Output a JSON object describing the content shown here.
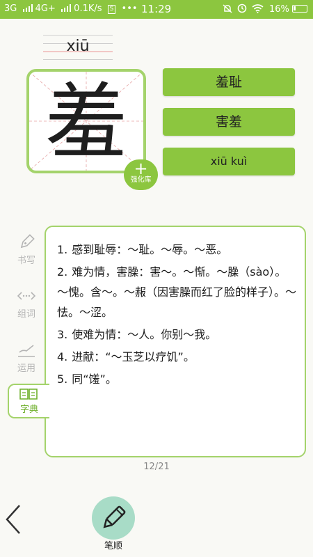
{
  "status_bar": {
    "network1": "3G",
    "network2": "4G+",
    "speed": "0.1K/s",
    "sim": "S",
    "dots": "•••",
    "time": "11:29",
    "battery": "16%",
    "color": "#8cc63f"
  },
  "character": {
    "pinyin": "xiū",
    "glyph": "羞"
  },
  "add_button": {
    "icon": "+",
    "label": "强化库"
  },
  "words": [
    "羞耻",
    "害羞",
    "xiū kuì"
  ],
  "side_tabs": [
    {
      "icon": "pen-nib-icon",
      "label": "书写"
    },
    {
      "icon": "link-dots-icon",
      "label": "组词"
    },
    {
      "icon": "brush-icon",
      "label": "运用"
    },
    {
      "icon": "book-icon",
      "label": "字典"
    }
  ],
  "definitions": [
    {
      "num": "1.",
      "text": "感到耻辱：～耻。～辱。～恶。"
    },
    {
      "num": "2.",
      "text": "难为情，害臊：害～。～惭。～臊（sào）。～愧。含～。～赧（因害臊而红了脸的样子）。～怯。～涩。"
    },
    {
      "num": "3.",
      "text": "使难为情：～人。你别～我。"
    },
    {
      "num": "4.",
      "text": "进献：“～玉芝以疗饥”。"
    },
    {
      "num": "5.",
      "text": "同“馐”。"
    }
  ],
  "page_indicator": "12/21",
  "bottom": {
    "stroke_label": "笔顺"
  },
  "colors": {
    "accent": "#8cc63f",
    "border": "#a4d36b",
    "active_tab": "#6fb02c"
  }
}
